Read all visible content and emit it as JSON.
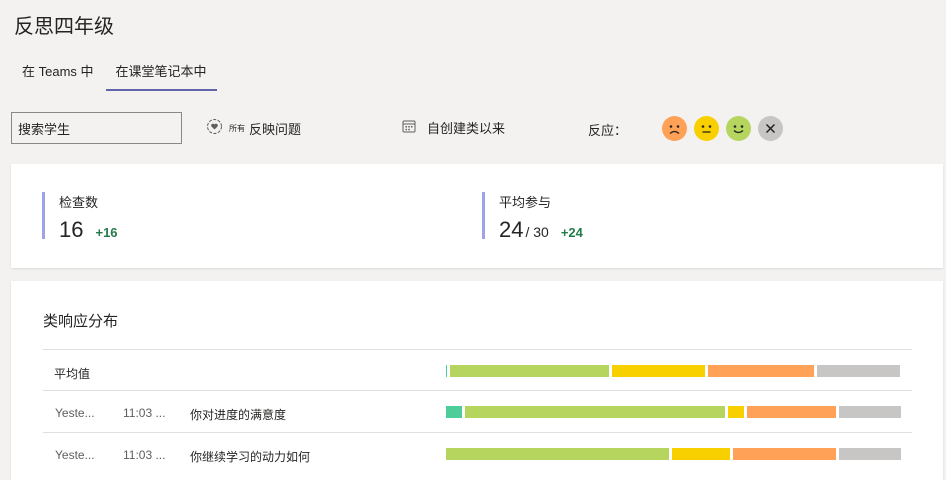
{
  "page": {
    "title": "反思四年级"
  },
  "tabs": [
    {
      "label": "在 Teams 中"
    },
    {
      "label": "在课堂笔记本中"
    }
  ],
  "toolbar": {
    "search_value": "搜索学生",
    "filter_small": "所有",
    "filter_label": "反映问题",
    "date_label": "自创建类以来",
    "reactions_label": "反应："
  },
  "colors": {
    "accent": "#6264a7",
    "stat_bar": "#9ea2e8",
    "delta": "#237b4b",
    "teal": "#4ecc9a",
    "green": "#b5d55e",
    "yellow": "#f8d000",
    "orange": "#ffa157",
    "gray": "#c8c6c4"
  },
  "stats": [
    {
      "label": "检查数",
      "value": "16",
      "suffix": "",
      "delta": "+16"
    },
    {
      "label": "平均参与",
      "value": "24",
      "suffix": "/ 30",
      "delta": "+24"
    }
  ],
  "distribution": {
    "title": "类响应分布",
    "average": {
      "label": "平均值",
      "segments": [
        {
          "color": "teal",
          "fraction": 0.003
        },
        {
          "color": "green",
          "fraction": 0.36
        },
        {
          "color": "yellow",
          "fraction": 0.21
        },
        {
          "color": "orange",
          "fraction": 0.24
        },
        {
          "color": "gray",
          "fraction": 0.187
        }
      ]
    },
    "rows": [
      {
        "date": "Yeste...",
        "time": "11:03 ...",
        "question": "你对进度的满意度",
        "segments": [
          {
            "color": "teal",
            "fraction": 0.035
          },
          {
            "color": "green",
            "fraction": 0.59
          },
          {
            "color": "yellow",
            "fraction": 0.035
          },
          {
            "color": "orange",
            "fraction": 0.2
          },
          {
            "color": "gray",
            "fraction": 0.14
          }
        ]
      },
      {
        "date": "Yeste...",
        "time": "11:03 ...",
        "question": "你继续学习的动力如何",
        "segments": [
          {
            "color": "green",
            "fraction": 0.5
          },
          {
            "color": "yellow",
            "fraction": 0.13
          },
          {
            "color": "orange",
            "fraction": 0.23
          },
          {
            "color": "gray",
            "fraction": 0.14
          }
        ]
      }
    ]
  }
}
